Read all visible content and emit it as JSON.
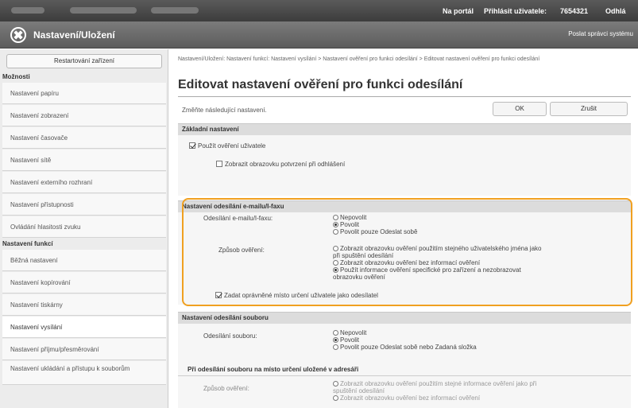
{
  "topbar": {
    "portal_link": "Na portál",
    "login_user": "Přihlásit uživatele:",
    "user_id": "7654321",
    "logout": "Odhlá"
  },
  "header": {
    "title": "Nastavení/Uložení",
    "report_link": "Poslat správci systému"
  },
  "sidebar": {
    "restart_button": "Restartování zařízení",
    "section_options": "Možnosti",
    "items_options": [
      "Nastavení papíru",
      "Nastavení zobrazení",
      "Nastavení časovače",
      "Nastavení sítě",
      "Nastavení externího rozhraní",
      "Nastavení přístupnosti",
      "Ovládání hlasitosti zvuku"
    ],
    "section_functions": "Nastavení funkcí",
    "items_functions": [
      "Běžná nastavení",
      "Nastavení kopírování",
      "Nastavení tiskárny",
      "Nastavení vysílání",
      "Nastavení příjmu/přesměrování",
      "Nastavení ukládání a přístupu k souborům"
    ]
  },
  "main": {
    "breadcrumb": "Nastavení/Uložení: Nastavení funkcí: Nastavení vysílání > Nastavení ověření pro funkci odesílání > Editovat nastavení ověření pro funkci odesílání",
    "page_title": "Editovat nastavení ověření pro funkci odesílání",
    "instruction": "Změňte následující nastavení.",
    "ok_button": "OK",
    "cancel_button": "Zrušit",
    "basic": {
      "header": "Základní nastavení",
      "use_user_auth": "Použít ověření uživatele",
      "show_confirm_screen": "Zobrazit obrazovku potvrzení při odhlášení"
    },
    "email_fax": {
      "header": "Nastavení odesílání e-mailu/I-faxu",
      "send_label": "Odesílání e-mailu/I-faxu:",
      "send_options": [
        "Nepovolit",
        "Povolit",
        "Povolit pouze Odeslat sobě"
      ],
      "auth_label": "Způsob ověření:",
      "auth_opt1_l1": "Zobrazit obrazovku ověření použitím stejného uživatelského jména jako",
      "auth_opt1_l2": "při spuštění odesílání",
      "auth_opt2": "Zobrazit obrazovku ověření bez informací ověření",
      "auth_opt3_l1": "Použít informace ověření specifické pro zařízení a nezobrazovat",
      "auth_opt3_l2": "obrazovku ověření",
      "specify_sender": "Zadat oprávněné místo určení uživatele jako odesílatel"
    },
    "file": {
      "header": "Nastavení odesílání souboru",
      "send_label": "Odesílání souboru:",
      "send_options": [
        "Nepovolit",
        "Povolit",
        "Povolit pouze Odeslat sobě nebo Zadaná složka"
      ],
      "sub_header": "Při odesílání souboru na místo určení uložené v adresáři",
      "auth_label": "Způsob ověření:",
      "auth_opt1_l1": "Zobrazit obrazovku ověření použitím stejné informace ověření jako při",
      "auth_opt1_l2": "spuštění odesílání",
      "auth_opt2": "Zobrazit obrazovku ověření bez informací ověření"
    }
  },
  "colors": {
    "highlight": "#f0a020",
    "header_bg": "#666666",
    "section_bg": "#dcdcdc"
  }
}
